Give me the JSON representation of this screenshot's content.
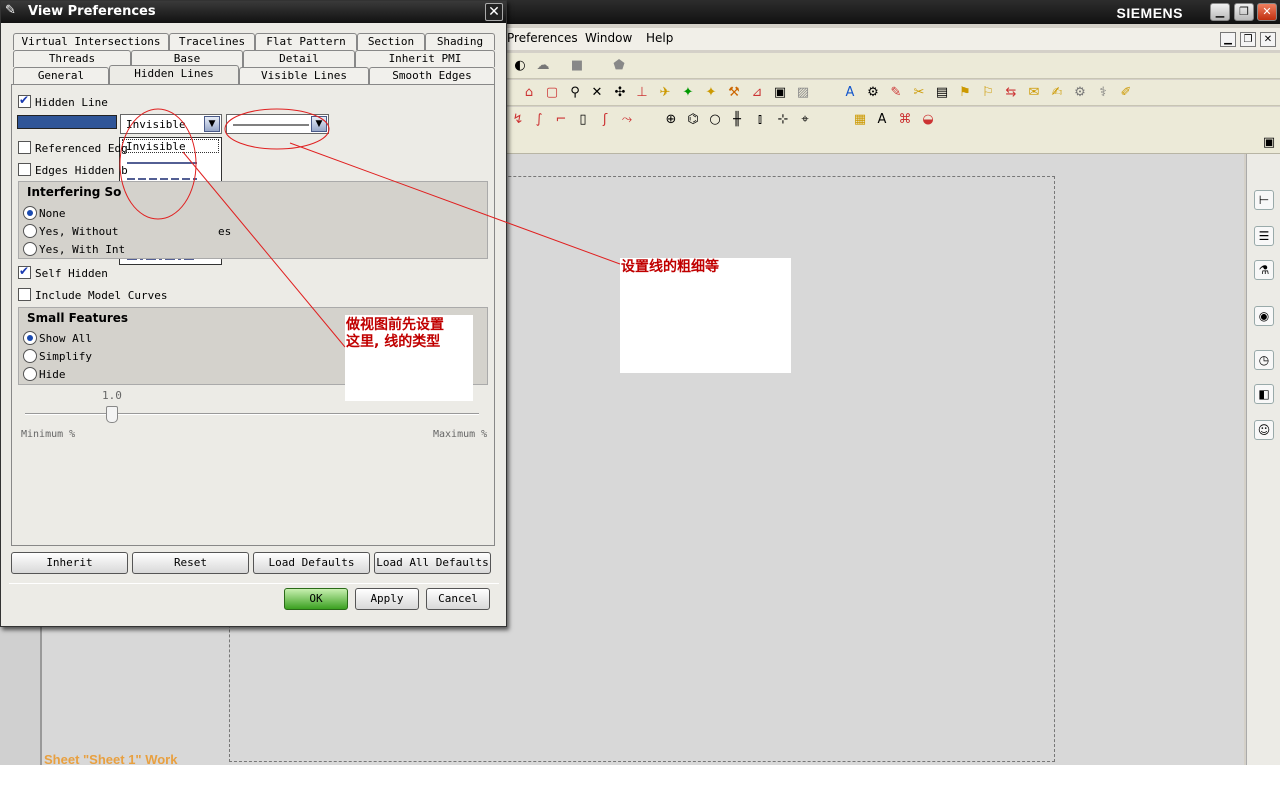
{
  "app": {
    "brand": "SIEMENS",
    "menu": [
      "Preferences",
      "Window",
      "Help"
    ],
    "status": "Sheet \"Sheet 1\" Work"
  },
  "dialog": {
    "title": "View Preferences",
    "tabs_row1": [
      "Virtual Intersections",
      "Tracelines",
      "Flat Pattern",
      "Section",
      "Shading"
    ],
    "tabs_row2": [
      "Threads",
      "Base",
      "Detail",
      "Inherit PMI"
    ],
    "tabs_row3": [
      "General",
      "Hidden Lines",
      "Visible Lines",
      "Smooth Edges"
    ],
    "active_tab": "Hidden Lines",
    "hidden_line_label": "Hidden Line",
    "hidden_line_checked": true,
    "line_color": "#2f5598",
    "line_type_value": "Invisible",
    "line_type_options": [
      "Invisible",
      "solid",
      "dashed",
      "phantom",
      "center",
      "dotted",
      "long-dashed",
      "dash-dot"
    ],
    "referenced_edges_label": "Referenced Edg",
    "edges_hidden_label": "Edges Hidden b",
    "interfering_title": "Interfering So",
    "interfering_options": [
      "None",
      "Yes, Without",
      "Yes, With Int"
    ],
    "interfering_fragment": "es",
    "self_hidden_label": "Self Hidden",
    "self_hidden_checked": true,
    "include_model_curves_label": "Include Model Curves",
    "small_features_title": "Small Features",
    "small_features_options": [
      "Show All",
      "Simplify",
      "Hide"
    ],
    "slider_value": "1.0",
    "slider_min_label": "Minimum %",
    "slider_max_label": "Maximum %",
    "buttons": [
      "Inherit",
      "Reset",
      "Load Defaults",
      "Load All Defaults"
    ],
    "ok_label": "OK",
    "apply_label": "Apply",
    "cancel_label": "Cancel"
  },
  "annotations": {
    "note1": "设置线的粗细等",
    "note2_line1": "做视图前先设置",
    "note2_line2": "这里, 线的类型",
    "color": "#c00000"
  }
}
